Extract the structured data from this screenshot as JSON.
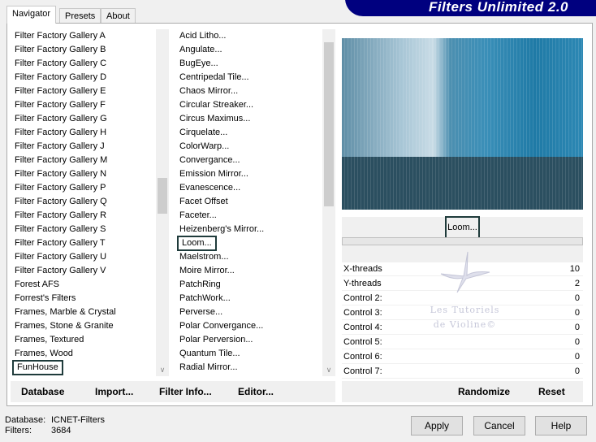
{
  "app_title": "Filters Unlimited 2.0",
  "tabs": [
    {
      "label": "Navigator"
    },
    {
      "label": "Presets"
    },
    {
      "label": "About"
    }
  ],
  "categories": [
    "Filter Factory Gallery A",
    "Filter Factory Gallery B",
    "Filter Factory Gallery C",
    "Filter Factory Gallery D",
    "Filter Factory Gallery E",
    "Filter Factory Gallery F",
    "Filter Factory Gallery G",
    "Filter Factory Gallery H",
    "Filter Factory Gallery J",
    "Filter Factory Gallery M",
    "Filter Factory Gallery N",
    "Filter Factory Gallery P",
    "Filter Factory Gallery Q",
    "Filter Factory Gallery R",
    "Filter Factory Gallery S",
    "Filter Factory Gallery T",
    "Filter Factory Gallery U",
    "Filter Factory Gallery V",
    "Forest AFS",
    "Forrest's Filters",
    "Frames, Marble & Crystal",
    "Frames, Stone & Granite",
    "Frames, Textured",
    "Frames, Wood",
    "FunHouse"
  ],
  "selected_category": "FunHouse",
  "filters": [
    "Acid Litho...",
    "Angulate...",
    "BugEye...",
    "Centripedal Tile...",
    "Chaos Mirror...",
    "Circular Streaker...",
    "Circus Maximus...",
    "Cirquelate...",
    "ColorWarp...",
    "Convergance...",
    "Emission Mirror...",
    "Evanescence...",
    "Facet Offset",
    "Faceter...",
    "Heizenberg's Mirror...",
    "Loom...",
    "Maelstrom...",
    "Moire Mirror...",
    "PatchRing",
    "PatchWork...",
    "Perverse...",
    "Polar Convergance...",
    "Polar Perversion...",
    "Quantum Tile...",
    "Radial Mirror..."
  ],
  "selected_filter": "Loom...",
  "left_buttons": {
    "database": "Database",
    "import": "Import...",
    "filter_info": "Filter Info...",
    "editor": "Editor..."
  },
  "filter_name_button": "Loom...",
  "params": [
    {
      "label": "X-threads",
      "value": "10"
    },
    {
      "label": "Y-threads",
      "value": "2"
    },
    {
      "label": "Control 2:",
      "value": "0"
    },
    {
      "label": "Control 3:",
      "value": "0"
    },
    {
      "label": "Control 4:",
      "value": "0"
    },
    {
      "label": "Control 5:",
      "value": "0"
    },
    {
      "label": "Control 6:",
      "value": "0"
    },
    {
      "label": "Control 7:",
      "value": "0"
    }
  ],
  "right_buttons": {
    "randomize": "Randomize",
    "reset": "Reset"
  },
  "watermark": "Les Tutoriels de Violine©",
  "status": {
    "database_label": "Database:",
    "database_value": "ICNET-Filters",
    "filters_label": "Filters:",
    "filters_value": "3684"
  },
  "dialog_buttons": {
    "apply": "Apply",
    "cancel": "Cancel",
    "help": "Help"
  },
  "colors": {
    "banner": "#00007f",
    "selection_outline": "#1f3b3b"
  }
}
